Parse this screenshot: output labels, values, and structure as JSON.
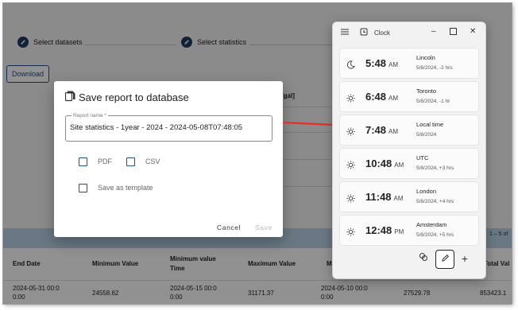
{
  "stepper": {
    "step1": "Select datasets",
    "step2": "Select statistics"
  },
  "download_label": "Download",
  "column_stub": "[gal]",
  "table": {
    "pagination": "1 – 5 of",
    "headers": [
      "End Date",
      "Minimum Value",
      "Minimum value Time",
      "Maximum Value",
      "M",
      "",
      "Total Val"
    ],
    "row": [
      "2024-05-31 00:0 0:00",
      "24558.62",
      "2024-05-15 00:0 0:00",
      "31171.37",
      "2024-05-10 00:0 0:00",
      "27529.78",
      "853423.1"
    ]
  },
  "dialog": {
    "title": "Save report to database",
    "field_label": "Report name *",
    "field_value": "Site statistics - 1year - 2024 - 2024-05-08T07:48:05",
    "checkboxes": {
      "pdf": "PDF",
      "csv": "CSV",
      "template": "Save as template"
    },
    "cancel": "Cancel",
    "save": "Save"
  },
  "clock": {
    "title": "Clock",
    "entries": [
      {
        "time": "5:48",
        "ampm": "AM",
        "city": "Lincoln",
        "detail": "5/8/2024, -2 hrs",
        "icon": "moon-icon"
      },
      {
        "time": "6:48",
        "ampm": "AM",
        "city": "Toronto",
        "detail": "5/8/2024, -1 hr",
        "icon": "sun-icon"
      },
      {
        "time": "7:48",
        "ampm": "AM",
        "city": "Local time",
        "detail": "5/8/2024",
        "icon": "sun-icon"
      },
      {
        "time": "10:48",
        "ampm": "AM",
        "city": "UTC",
        "detail": "5/8/2024, +3 hrs",
        "icon": "sun-icon"
      },
      {
        "time": "11:48",
        "ampm": "AM",
        "city": "London",
        "detail": "5/8/2024, +4 hrs",
        "icon": "sun-icon"
      },
      {
        "time": "12:48",
        "ampm": "PM",
        "city": "Amsterdam",
        "detail": "5/8/2024, +5 hrs",
        "icon": "sun-icon"
      }
    ]
  },
  "colors": {
    "accent": "#1e4f8f",
    "table_band": "#b9d3e8",
    "arrow": "#e0342f"
  }
}
